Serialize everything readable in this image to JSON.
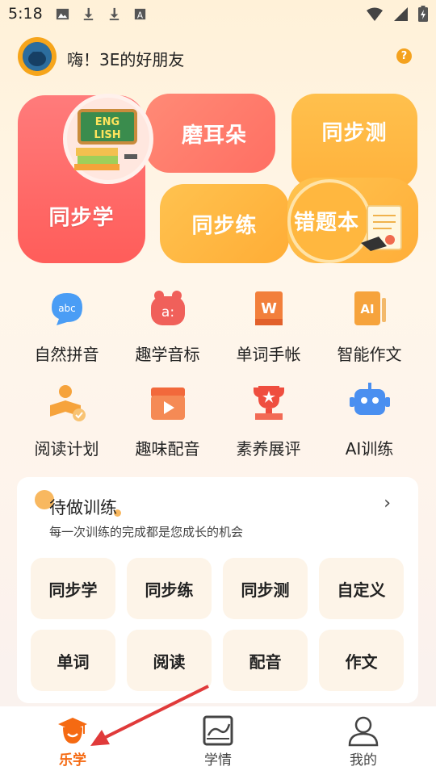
{
  "status_bar": {
    "time": "5:18",
    "left_icons": [
      "image-icon",
      "download-icon",
      "download-icon",
      "font-a-icon"
    ],
    "right_icons": [
      "wifi-icon",
      "signal-icon",
      "battery-charging-icon"
    ]
  },
  "header": {
    "greeting": "嗨！3E的好朋友",
    "help_icon": "?"
  },
  "feature_cards": {
    "xue": "同步学",
    "ear": "磨耳朵",
    "ce": "同步测",
    "lian": "同步练",
    "cuo": "错题本",
    "english_badge": [
      "ENG",
      "LISH"
    ]
  },
  "grid": [
    {
      "label": "自然拼音",
      "icon": "abc-icon",
      "color": "#4a9df5"
    },
    {
      "label": "趣学音标",
      "icon": "phonetic-icon",
      "color": "#f0605a"
    },
    {
      "label": "单词手帐",
      "icon": "word-book-icon",
      "color": "#f27f3b"
    },
    {
      "label": "智能作文",
      "icon": "ai-writing-icon",
      "color": "#f6a33c"
    },
    {
      "label": "阅读计划",
      "icon": "reading-plan-icon",
      "color": "#f6a33c"
    },
    {
      "label": "趣味配音",
      "icon": "video-dubbing-icon",
      "color": "#f2693b"
    },
    {
      "label": "素养展评",
      "icon": "trophy-icon",
      "color": "#ef4e3f"
    },
    {
      "label": "AI训练",
      "icon": "robot-icon",
      "color": "#4a8ff0"
    }
  ],
  "todo": {
    "title": "待做训练",
    "subtitle": "每一次训练的完成都是您成长的机会",
    "buttons": [
      "同步学",
      "同步练",
      "同步测",
      "自定义",
      "单词",
      "阅读",
      "配音",
      "作文"
    ]
  },
  "bottom_nav": [
    {
      "label": "乐学",
      "icon": "graduation-cap-icon",
      "active": true
    },
    {
      "label": "学情",
      "icon": "chart-board-icon",
      "active": false
    },
    {
      "label": "我的",
      "icon": "user-icon",
      "active": false
    }
  ],
  "colors": {
    "accent": "#f56a12",
    "card_red": "#ff6262",
    "card_orange": "#ffb23c"
  }
}
